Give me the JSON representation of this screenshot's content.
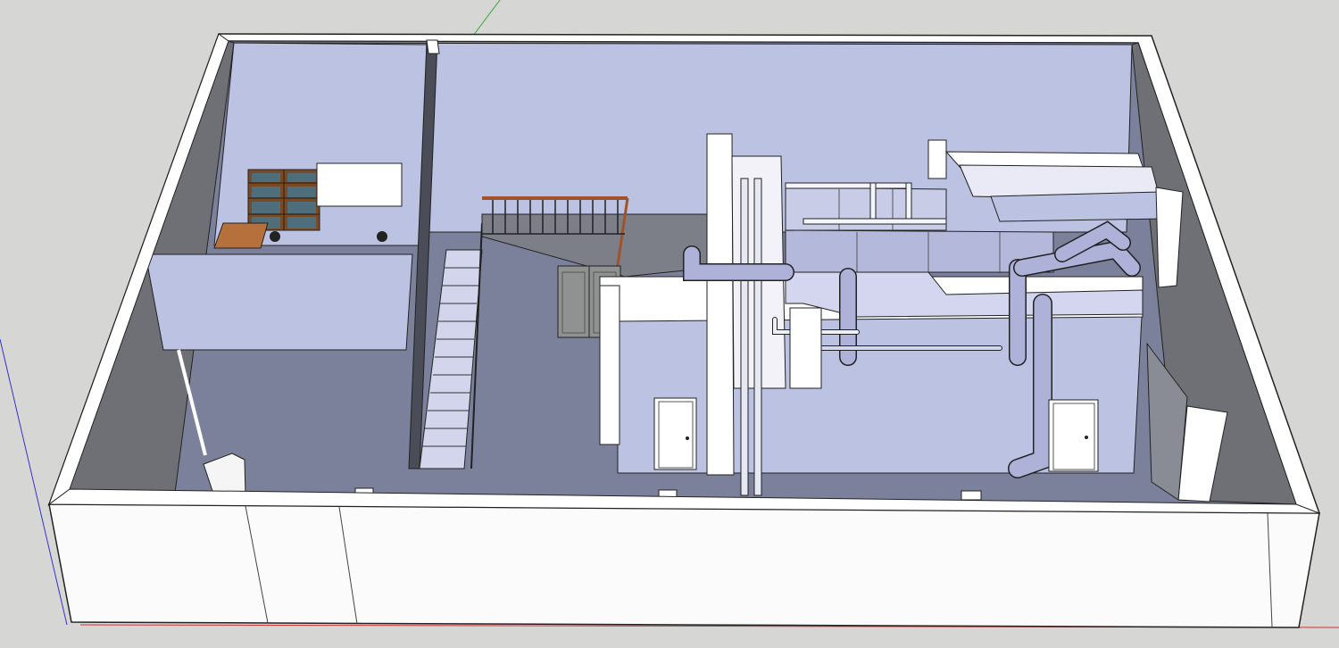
{
  "scene": {
    "colors": {
      "background": "#d6d6d4",
      "ground_line": "#b9b9b7",
      "wall_top": "#ffffff",
      "exterior_wall": "#fbfbfb",
      "interior_wall_lavender": "#bcc2e2",
      "dark_wall": "#6f7076",
      "floor": "#7c819b",
      "outline": "#222222",
      "duct": "#aeb2d8",
      "duct_light": "#d3d6ee",
      "railing_wood": "#a0532a",
      "bookshelf": "#7a4a25",
      "desk": "#b5703c",
      "door": "#ffffff",
      "double_door": "#8f9290",
      "axis_red": "#cc3333",
      "axis_green": "#33aa33",
      "axis_blue": "#3333cc"
    },
    "icons": [
      "axis-icon"
    ]
  }
}
